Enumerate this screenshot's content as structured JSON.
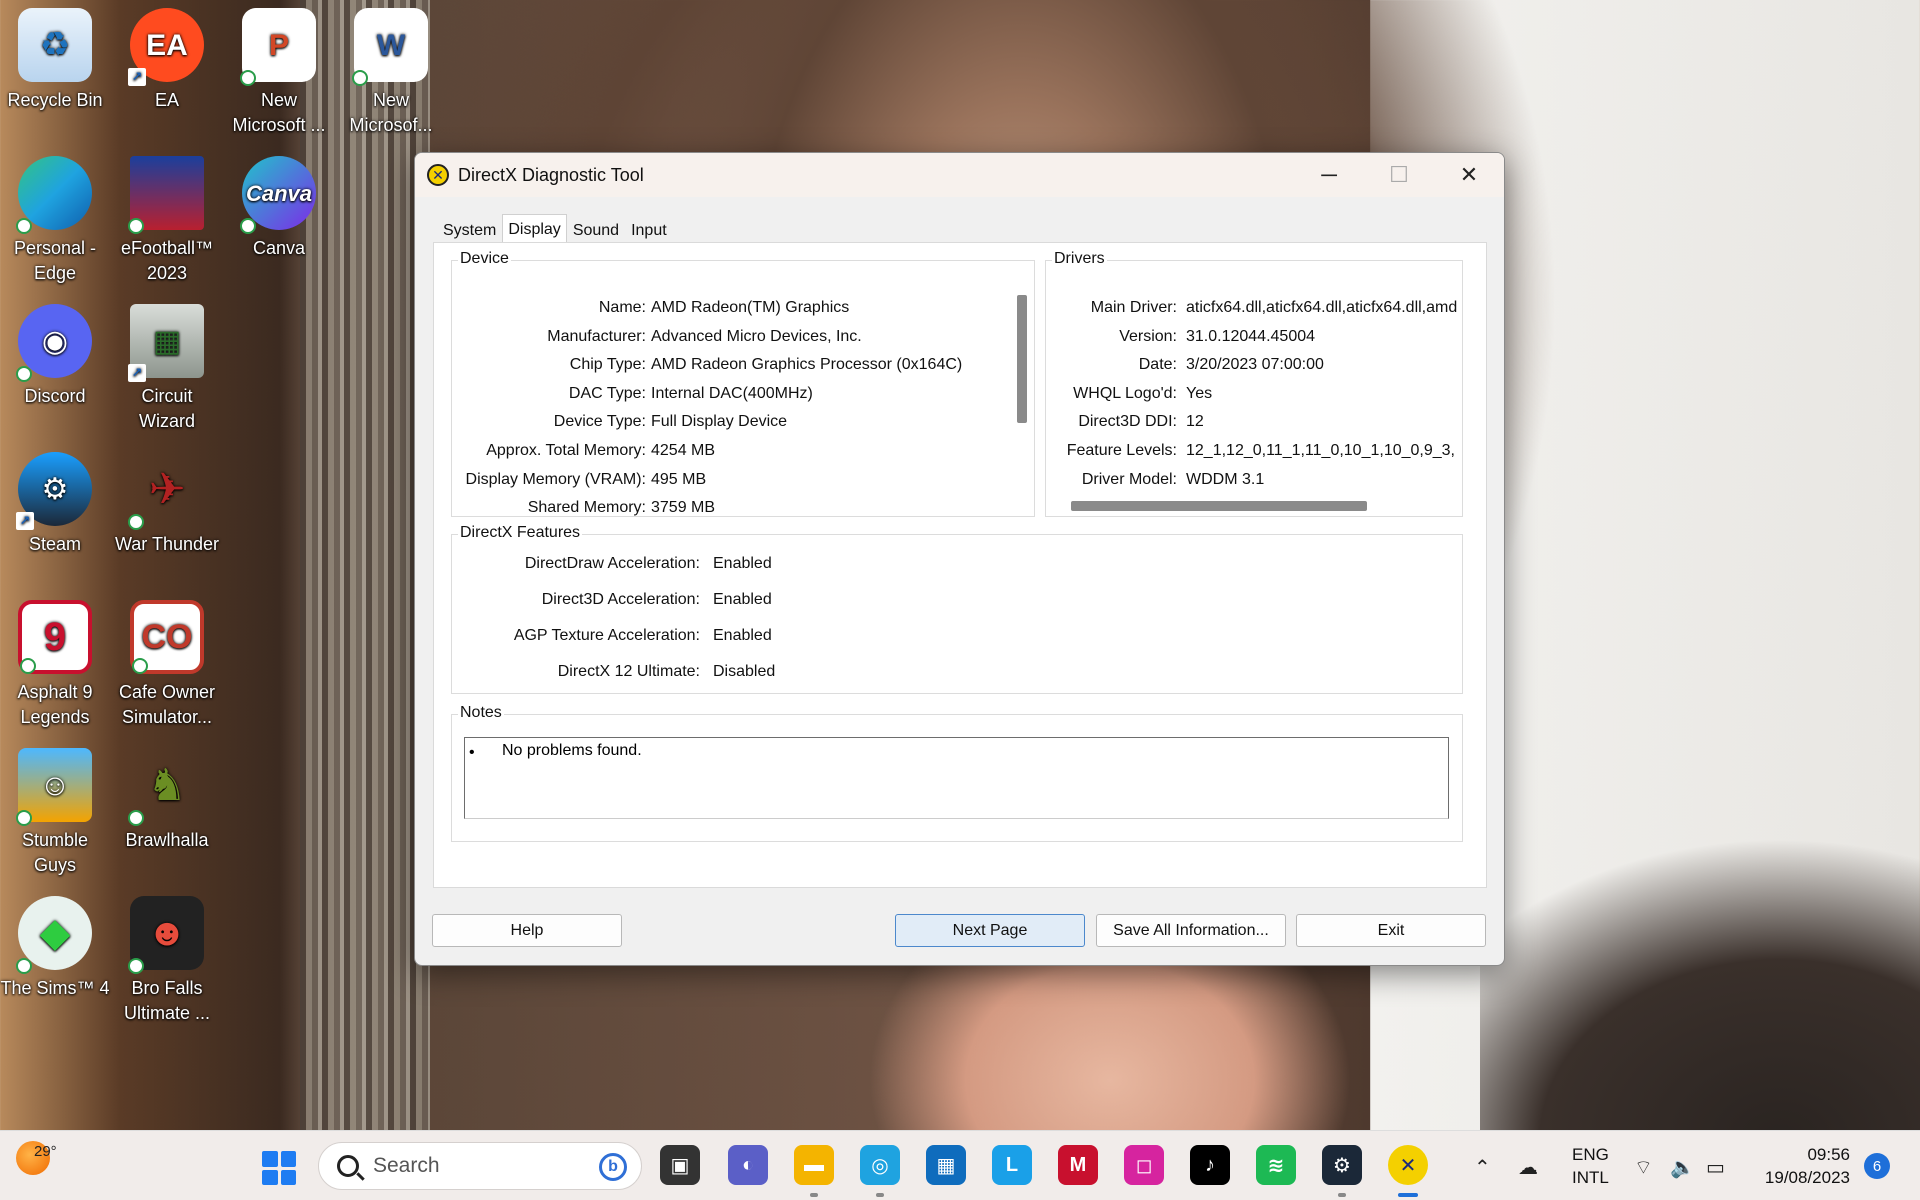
{
  "desktop": {
    "icons": [
      {
        "label": "Recycle Bin",
        "icon": "recycle-bin-icon",
        "color": "#cfe3f5"
      },
      {
        "label": "EA",
        "icon": "ea-icon",
        "color": "#ff4b1f"
      },
      {
        "label": "New Microsoft ...",
        "icon": "powerpoint-icon",
        "color": "#d24726"
      },
      {
        "label": "New Microsof...",
        "icon": "word-icon",
        "color": "#2b579a"
      },
      {
        "label": "Personal - Edge",
        "icon": "edge-icon",
        "color": "#1fa3e0"
      },
      {
        "label": "eFootball™ 2023",
        "icon": "efootball-icon",
        "color": "#1b3f9c"
      },
      {
        "label": "Canva",
        "icon": "canva-icon",
        "color": "#20c4cb"
      },
      {
        "label": "Discord",
        "icon": "discord-icon",
        "color": "#5865f2"
      },
      {
        "label": "Circuit Wizard",
        "icon": "circuit-wizard-icon",
        "color": "#9aa29a"
      },
      {
        "label": "Steam",
        "icon": "steam-icon",
        "color": "#1b2838"
      },
      {
        "label": "War Thunder",
        "icon": "war-thunder-icon",
        "color": "#8b1a1a"
      },
      {
        "label": "Asphalt 9 Legends",
        "icon": "asphalt-icon",
        "color": "#c8102e"
      },
      {
        "label": "Cafe Owner Simulator...",
        "icon": "cafe-owner-icon",
        "color": "#c0392b"
      },
      {
        "label": "Stumble Guys",
        "icon": "stumble-guys-icon",
        "color": "#4db8ff"
      },
      {
        "label": "Brawlhalla",
        "icon": "brawlhalla-icon",
        "color": "#6b8e23"
      },
      {
        "label": "The Sims™ 4",
        "icon": "sims-icon",
        "color": "#2ecc40"
      },
      {
        "label": "Bro Falls Ultimate ...",
        "icon": "bro-falls-icon",
        "color": "#e74c3c"
      }
    ]
  },
  "window": {
    "title": "DirectX Diagnostic Tool",
    "tabs": [
      "System",
      "Display",
      "Sound",
      "Input"
    ],
    "active_tab": "Display",
    "device": {
      "title": "Device",
      "rows": [
        {
          "k": "Name:",
          "v": "AMD Radeon(TM) Graphics"
        },
        {
          "k": "Manufacturer:",
          "v": "Advanced Micro Devices, Inc."
        },
        {
          "k": "Chip Type:",
          "v": "AMD Radeon Graphics Processor (0x164C)"
        },
        {
          "k": "DAC Type:",
          "v": "Internal DAC(400MHz)"
        },
        {
          "k": "Device Type:",
          "v": "Full Display Device"
        },
        {
          "k": "Approx. Total Memory:",
          "v": "4254 MB"
        },
        {
          "k": "Display Memory (VRAM):",
          "v": "495 MB"
        },
        {
          "k": "Shared Memory:",
          "v": "3759 MB"
        }
      ]
    },
    "drivers": {
      "title": "Drivers",
      "rows": [
        {
          "k": "Main Driver:",
          "v": "aticfx64.dll,aticfx64.dll,aticfx64.dll,amd"
        },
        {
          "k": "Version:",
          "v": "31.0.12044.45004"
        },
        {
          "k": "Date:",
          "v": "3/20/2023 07:00:00"
        },
        {
          "k": "WHQL Logo'd:",
          "v": "Yes"
        },
        {
          "k": "Direct3D DDI:",
          "v": "12"
        },
        {
          "k": "Feature Levels:",
          "v": "12_1,12_0,11_1,11_0,10_1,10_0,9_3,"
        },
        {
          "k": "Driver Model:",
          "v": "WDDM 3.1"
        }
      ]
    },
    "features": {
      "title": "DirectX Features",
      "rows": [
        {
          "k": "DirectDraw Acceleration:",
          "v": "Enabled"
        },
        {
          "k": "Direct3D Acceleration:",
          "v": "Enabled"
        },
        {
          "k": "AGP Texture Acceleration:",
          "v": "Enabled"
        },
        {
          "k": "DirectX 12 Ultimate:",
          "v": "Disabled"
        }
      ]
    },
    "notes": {
      "title": "Notes",
      "bullet": "•",
      "lines": [
        "No problems found."
      ]
    },
    "buttons": {
      "help": "Help",
      "next_page": "Next Page",
      "save_all": "Save All Information...",
      "exit": "Exit"
    }
  },
  "taskbar": {
    "weather_temp": "29°",
    "search_placeholder": "Search",
    "apps": [
      {
        "name": "task-view-icon",
        "color": "#333333"
      },
      {
        "name": "teams-chat-icon",
        "color": "#5b5fc7"
      },
      {
        "name": "file-explorer-icon",
        "color": "#f4b400"
      },
      {
        "name": "edge-icon",
        "color": "#1fa3e0"
      },
      {
        "name": "microsoft-store-icon",
        "color": "#0f6cbd"
      },
      {
        "name": "l-app-icon",
        "color": "#1aa0e8"
      },
      {
        "name": "mcafee-icon",
        "color": "#c8102e"
      },
      {
        "name": "instagram-icon",
        "color": "#d6249f"
      },
      {
        "name": "tiktok-icon",
        "color": "#000000"
      },
      {
        "name": "spotify-icon",
        "color": "#1db954"
      },
      {
        "name": "steam-icon",
        "color": "#1b2838"
      },
      {
        "name": "directx-icon",
        "color": "#f4d000"
      }
    ],
    "lang_top": "ENG",
    "lang_bottom": "INTL",
    "time": "09:56",
    "date": "19/08/2023",
    "notifications": "6"
  }
}
